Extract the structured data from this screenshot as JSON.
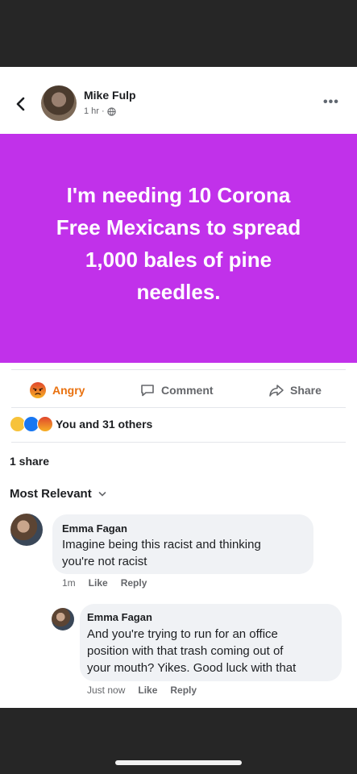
{
  "post": {
    "author": "Mike Fulp",
    "time": "1 hr",
    "separator": "·",
    "text_lines": [
      "I'm needing 10 Corona",
      "Free Mexicans to spread",
      "1,000 bales of pine",
      "needles."
    ],
    "background_color": "#c131ea"
  },
  "actions": {
    "reaction_label": "Angry",
    "comment_label": "Comment",
    "share_label": "Share"
  },
  "reactions": {
    "summary": "You and 31 others",
    "icons": [
      "haha-icon",
      "like-icon",
      "angry-icon"
    ]
  },
  "shares": "1 share",
  "sort_label": "Most Relevant",
  "comments": [
    {
      "name": "Emma Fagan",
      "text_lines": [
        "Imagine being this racist and thinking",
        "you're not racist"
      ],
      "time": "1m",
      "like": "Like",
      "reply": "Reply"
    },
    {
      "name": "Emma Fagan",
      "text_lines": [
        "And you're trying to run for an office",
        "position with that trash coming out of",
        "your mouth? Yikes. Good luck with that"
      ],
      "time": "Just now",
      "like": "Like",
      "reply": "Reply"
    }
  ],
  "icons": {
    "back": "chevron-left-icon",
    "more": "more-icon",
    "privacy": "globe-icon",
    "comment": "comment-icon",
    "share": "share-icon",
    "sort": "chevron-down-icon"
  },
  "colors": {
    "angry": "#e9710f",
    "muted": "#65676b",
    "bubble": "#f0f2f5"
  }
}
